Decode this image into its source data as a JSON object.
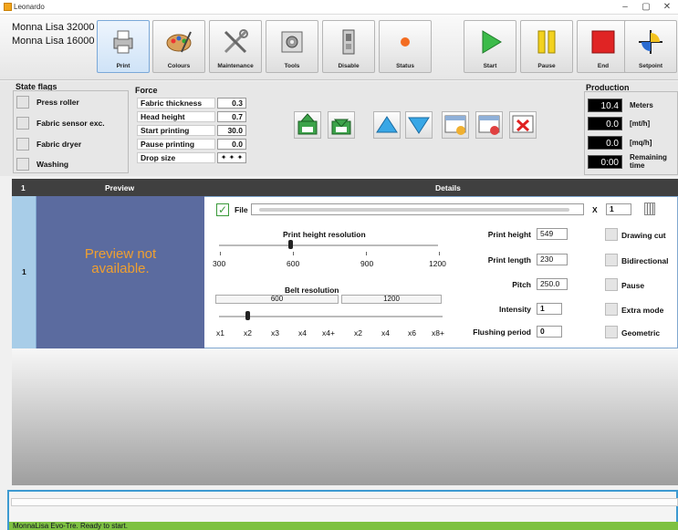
{
  "window": {
    "title": "Leonardo",
    "min": "–",
    "max": "▢",
    "close": "✕"
  },
  "machine": {
    "line1": "Monna Lisa 32000",
    "line2": "Monna Lisa 16000"
  },
  "toolbar": {
    "print": "Print",
    "colours": "Colours",
    "maintenance": "Maintenance",
    "tools": "Tools",
    "disable": "Disable",
    "status": "Status",
    "start": "Start",
    "pause": "Pause",
    "end": "End",
    "setpoint": "Setpoint"
  },
  "state_flags": {
    "title": "State flags",
    "items": [
      "Press roller",
      "Fabric sensor exc.",
      "Fabric dryer",
      "Washing"
    ]
  },
  "force": {
    "title": "Force",
    "rows": [
      {
        "label": "Fabric thickness",
        "value": "0.3"
      },
      {
        "label": "Head height",
        "value": "0.7"
      },
      {
        "label": "Start printing",
        "value": "30.0"
      },
      {
        "label": "Pause printing",
        "value": "0.0"
      }
    ],
    "drop_size_label": "Drop size"
  },
  "production": {
    "title": "Production",
    "meters_value": "10.4",
    "meters_unit": "Meters",
    "mh_value": "0.0",
    "mh_unit": "[mt/h]",
    "sqh_value": "0.0",
    "sqh_unit": "[mq/h]",
    "time_value": "0:00",
    "time_unit": "Remaining time"
  },
  "table": {
    "col_num": "1",
    "col_preview": "Preview",
    "col_details": "Details"
  },
  "row": {
    "number": "1",
    "preview_text": "Preview not available."
  },
  "details": {
    "file_label": "File",
    "copies_x": "X",
    "copies": "1",
    "print_height_resolution": "Print height resolution",
    "res_ticks": [
      "300",
      "600",
      "900",
      "1200"
    ],
    "belt_resolution": "Belt resolution",
    "belt_600": "600",
    "belt_1200": "1200",
    "belt_ticks": [
      "x1",
      "x2",
      "x3",
      "x4",
      "x4+",
      "x2",
      "x4",
      "x6",
      "x8+"
    ],
    "print_height_label": "Print height",
    "print_height": "549",
    "print_length_label": "Print length",
    "print_length": "230",
    "pitch_label": "Pitch",
    "pitch": "250.0",
    "intensity_label": "Intensity",
    "intensity": "1",
    "flushing_label": "Flushing period",
    "flushing": "0",
    "options": [
      "Drawing cut",
      "Bidirectional",
      "Pause",
      "Extra mode",
      "Geometric"
    ]
  },
  "status": {
    "message": "MonnaLisa Evo-Tre. Ready to start."
  },
  "colors": {
    "accent": "#3d9ad1",
    "status_green": "#7ec142",
    "preview_bg": "#5b6b9f",
    "preview_text": "#f0a030"
  }
}
